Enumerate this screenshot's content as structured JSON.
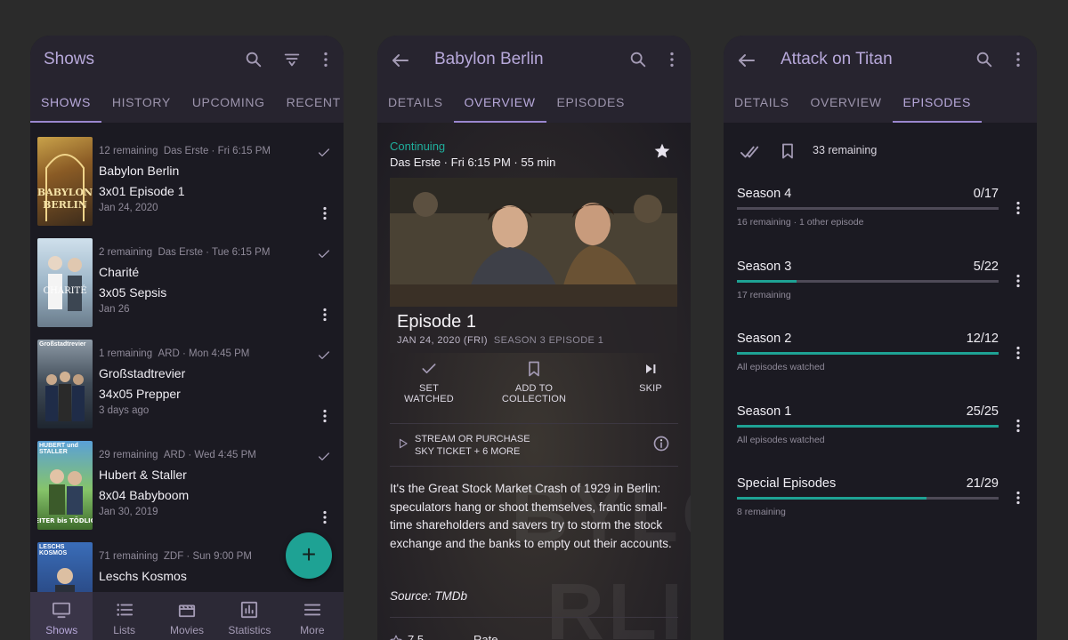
{
  "colors": {
    "accent": "#b7a8da",
    "teal": "#1ea294",
    "background": "#1b1a22",
    "appbar": "#27242f"
  },
  "shows_screen": {
    "title": "Shows",
    "tabs": [
      "SHOWS",
      "HISTORY",
      "UPCOMING",
      "RECENT"
    ],
    "active_tab": 0,
    "items": [
      {
        "remaining": "12 remaining",
        "network": "Das Erste · Fri 6:15 PM",
        "name": "Babylon Berlin",
        "episode": "3x01 Episode 1",
        "date": "Jan 24, 2020",
        "poster_text": ""
      },
      {
        "remaining": "2 remaining",
        "network": "Das Erste · Tue 6:15 PM",
        "name": "Charité",
        "episode": "3x05 Sepsis",
        "date": "Jan 26",
        "poster_text": ""
      },
      {
        "remaining": "1 remaining",
        "network": "ARD · Mon 4:45 PM",
        "name": "Großstadtrevier",
        "episode": "34x05 Prepper",
        "date": "3 days ago",
        "poster_text": "Großstadtrevier"
      },
      {
        "remaining": "29 remaining",
        "network": "ARD · Wed 4:45 PM",
        "name": "Hubert & Staller",
        "episode": "8x04 Babyboom",
        "date": "Jan 30, 2019",
        "poster_text": "HUBERT und STALLER"
      },
      {
        "remaining": "71 remaining",
        "network": "ZDF · Sun 9:00 PM",
        "name": "Leschs Kosmos",
        "episode": "",
        "date": "",
        "poster_text": "LESCHS KOSMOS"
      }
    ],
    "fab_label": "+",
    "nav": [
      "Shows",
      "Lists",
      "Movies",
      "Statistics",
      "More"
    ],
    "active_nav": 0
  },
  "overview_screen": {
    "title": "Babylon Berlin",
    "tabs": [
      "DETAILS",
      "OVERVIEW",
      "EPISODES"
    ],
    "active_tab": 1,
    "status": "Continuing",
    "airtime": "Das Erste · Fri 6:15 PM · 55 min",
    "episode_title": "Episode 1",
    "episode_date": "JAN 24, 2020 (FRI)",
    "episode_number": "SEASON 3 EPISODE 1",
    "actions": {
      "set_watched": "SET WATCHED",
      "collection_1": "ADD TO",
      "collection_2": "COLLECTION",
      "skip": "SKIP"
    },
    "stream_1": "STREAM OR PURCHASE",
    "stream_2": "SKY TICKET + 6 MORE",
    "description": "It's the Great Stock Market Crash of 1929 in Berlin: speculators hang or shoot themselves, frantic small-time shareholders and savers try to storm the stock exchange and the banks to empty out their accounts.",
    "source": "Source: TMDb",
    "rating": "7.5 ...",
    "rate": "Rate"
  },
  "episodes_screen": {
    "title": "Attack on Titan",
    "tabs": [
      "DETAILS",
      "OVERVIEW",
      "EPISODES"
    ],
    "active_tab": 2,
    "remaining": "33 remaining",
    "seasons": [
      {
        "name": "Season 4",
        "count": "0/17",
        "progress": 0.0,
        "sub": "16 remaining · 1 other episode"
      },
      {
        "name": "Season 3",
        "count": "5/22",
        "progress": 0.227,
        "sub": "17 remaining"
      },
      {
        "name": "Season 2",
        "count": "12/12",
        "progress": 1.0,
        "sub": "All episodes watched"
      },
      {
        "name": "Season 1",
        "count": "25/25",
        "progress": 1.0,
        "sub": "All episodes watched"
      },
      {
        "name": "Special Episodes",
        "count": "21/29",
        "progress": 0.724,
        "sub": "8 remaining"
      }
    ]
  }
}
